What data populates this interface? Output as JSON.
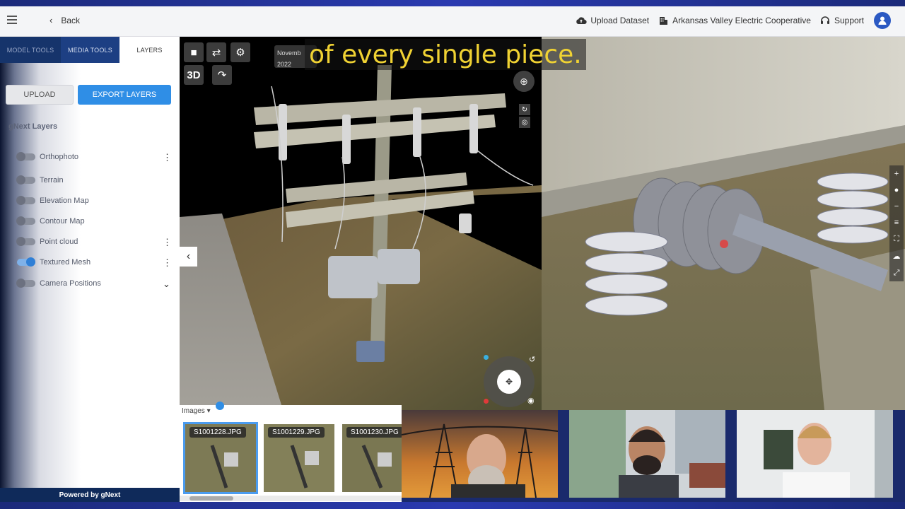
{
  "topbar": {
    "back_label": "Back",
    "upload_dataset": "Upload Dataset",
    "organization": "Arkansas Valley Electric Cooperative",
    "support": "Support"
  },
  "sidebar": {
    "tabs": [
      "MODEL TOOLS",
      "MEDIA TOOLS",
      "LAYERS"
    ],
    "upload_button": "UPLOAD",
    "export_button": "EXPORT LAYERS",
    "heading": "gNext Layers",
    "layers": [
      {
        "label": "Orthophoto",
        "on": false
      },
      {
        "label": "Terrain",
        "on": false
      },
      {
        "label": "Elevation Map",
        "on": false
      },
      {
        "label": "Contour Map",
        "on": false
      },
      {
        "label": "Point cloud",
        "on": false
      },
      {
        "label": "Textured Mesh",
        "on": true
      },
      {
        "label": "Camera Positions",
        "on": false
      }
    ],
    "powered_by": "Powered by gNext"
  },
  "viewer": {
    "date_line1": "Novemb",
    "date_line2": "2022",
    "mode_3d": "3D",
    "caption": "of every single piece."
  },
  "images": {
    "dropdown_label": "Images",
    "thumbnails": [
      "S1001228.JPG",
      "S1001229.JPG",
      "S1001230.JPG"
    ]
  },
  "colors": {
    "accent": "#2f8ee6",
    "caption_text": "#f0d233",
    "powered_bar": "#0f2a5a"
  }
}
